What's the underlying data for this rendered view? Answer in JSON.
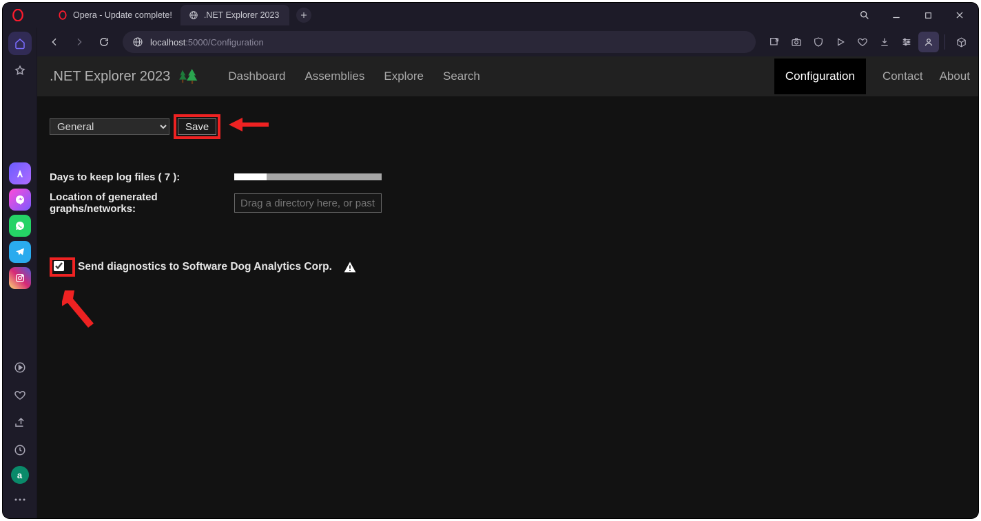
{
  "titlebar": {
    "tabs": [
      {
        "title": "Opera - Update complete!"
      },
      {
        "title": ".NET Explorer 2023"
      }
    ]
  },
  "address": {
    "host": "localhost",
    "port_path": ":5000/Configuration"
  },
  "appHeader": {
    "brand": ".NET Explorer 2023",
    "menu": [
      "Dashboard",
      "Assemblies",
      "Explore",
      "Search"
    ],
    "right": [
      "Configuration",
      "Contact",
      "About"
    ],
    "active_right": "Configuration"
  },
  "config": {
    "section_selected": "General",
    "save_label": "Save",
    "days_label": "Days to keep log files ( 7 ):",
    "location_label": "Location of generated graphs/networks:",
    "location_placeholder": "Drag a directory here, or paste",
    "diag_label": "Send diagnostics to Software Dog Analytics Corp.",
    "diag_checked": true
  },
  "annotations": {
    "highlight_save": true,
    "highlight_checkbox": true
  }
}
